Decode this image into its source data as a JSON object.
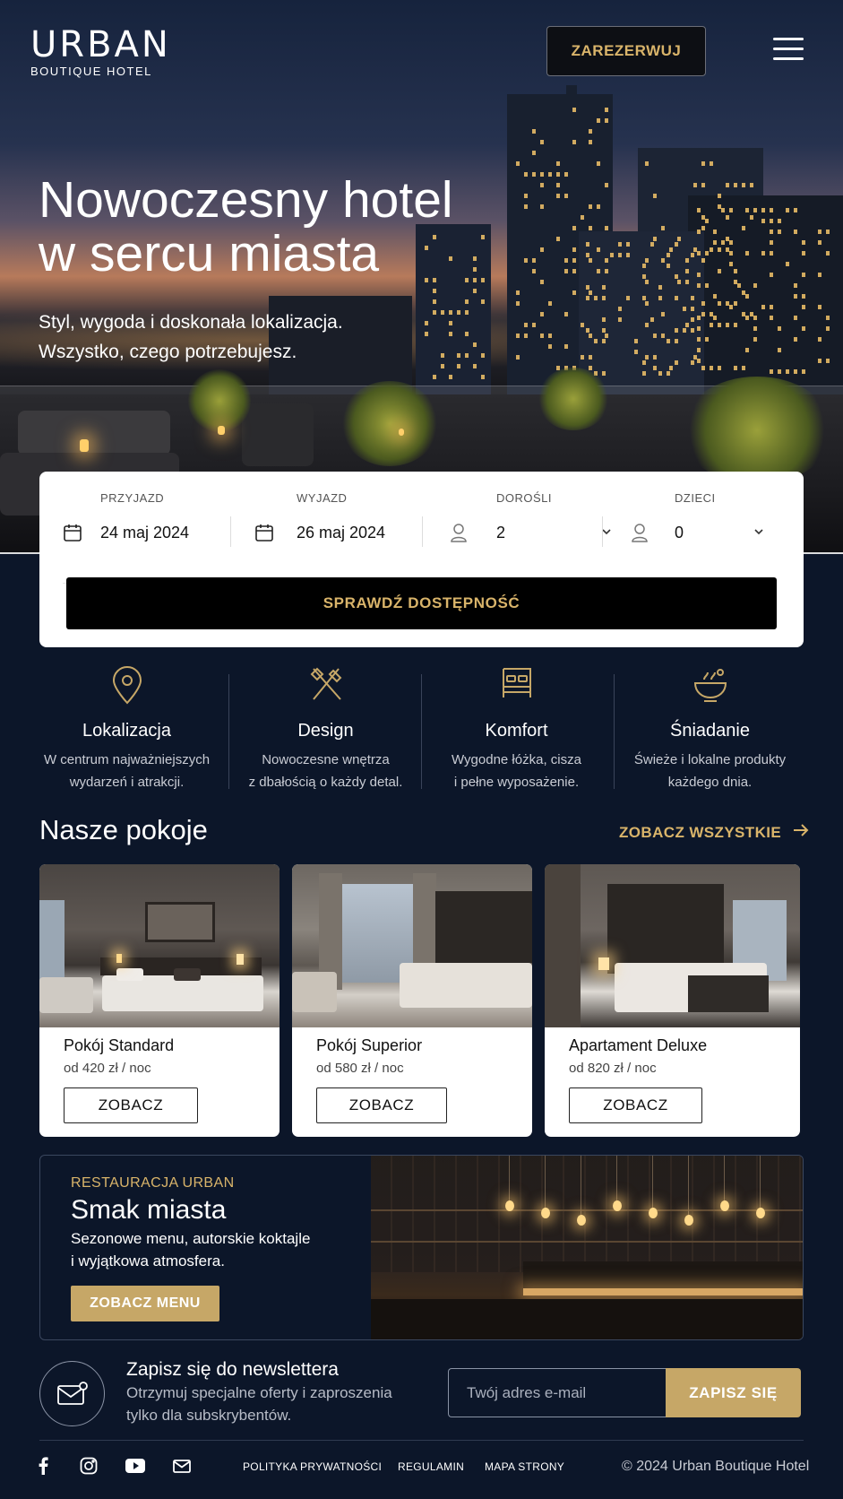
{
  "header": {
    "logo_title": "URBAN",
    "logo_subtitle": "BOUTIQUE HOTEL",
    "reserve_label": "ZAREZERWUJ",
    "menu_icon": "hamburger-menu-icon"
  },
  "hero": {
    "title_line1": "Nowoczesny hotel",
    "title_line2": "w sercu miasta",
    "subtitle_line1": "Styl, wygoda i doskonała lokalizacja.",
    "subtitle_line2": "Wszystko, czego potrzebujesz."
  },
  "booking": {
    "checkin_label": "PRZYJAZD",
    "checkin_value": "24 maj 2024",
    "checkout_label": "WYJAZD",
    "checkout_value": "26 maj 2024",
    "adults_label": "DOROŚLI",
    "adults_value": "2",
    "children_label": "DZIECI",
    "children_value": "0",
    "submit_label": "SPRAWDŹ DOSTĘPNOŚĆ"
  },
  "features": [
    {
      "icon": "location-pin-icon",
      "title": "Lokalizacja",
      "desc1": "W centrum najważniejszych",
      "desc2": "wydarzeń i atrakcji."
    },
    {
      "icon": "design-tools-icon",
      "title": "Design",
      "desc1": "Nowoczesne wnętrza",
      "desc2": "z dbałością o każdy detal."
    },
    {
      "icon": "bed-icon",
      "title": "Komfort",
      "desc1": "Wygodne łóżka, cisza",
      "desc2": "i pełne wyposażenie."
    },
    {
      "icon": "breakfast-bowl-icon",
      "title": "Śniadanie",
      "desc1": "Świeże i lokalne produkty",
      "desc2": "każdego dnia."
    }
  ],
  "rooms_section": {
    "title": "Nasze pokoje",
    "see_all_label": "ZOBACZ WSZYSTKIE"
  },
  "rooms": [
    {
      "name": "Pokój Standard",
      "price": "od 420 zł / noc",
      "button": "ZOBACZ"
    },
    {
      "name": "Pokój Superior",
      "price": "od 580 zł / noc",
      "button": "ZOBACZ"
    },
    {
      "name": "Apartament Deluxe",
      "price": "od 820 zł / noc",
      "button": "ZOBACZ"
    }
  ],
  "restaurant": {
    "kicker": "RESTAURACJA URBAN",
    "title": "Smak miasta",
    "desc_line1": "Sezonowe menu, autorskie koktajle",
    "desc_line2": "i wyjątkowa atmosfera.",
    "button": "ZOBACZ MENU"
  },
  "newsletter": {
    "title": "Zapisz się do newslettera",
    "desc_line1": "Otrzymuj specjalne oferty i zaproszenia",
    "desc_line2": "tylko dla subskrybentów.",
    "input_placeholder": "Twój adres e-mail",
    "button": "ZAPISZ SIĘ"
  },
  "footer": {
    "links": [
      "POLITYKA PRYWATNOŚCI",
      "REGULAMIN",
      "MAPA STRONY"
    ],
    "copyright": "© 2024 Urban Boutique Hotel",
    "social_icons": [
      "facebook-icon",
      "instagram-icon",
      "youtube-icon",
      "email-icon"
    ]
  },
  "colors": {
    "background": "#0c1629",
    "accent_gold": "#d9b46a",
    "button_gold": "#c6a767"
  }
}
